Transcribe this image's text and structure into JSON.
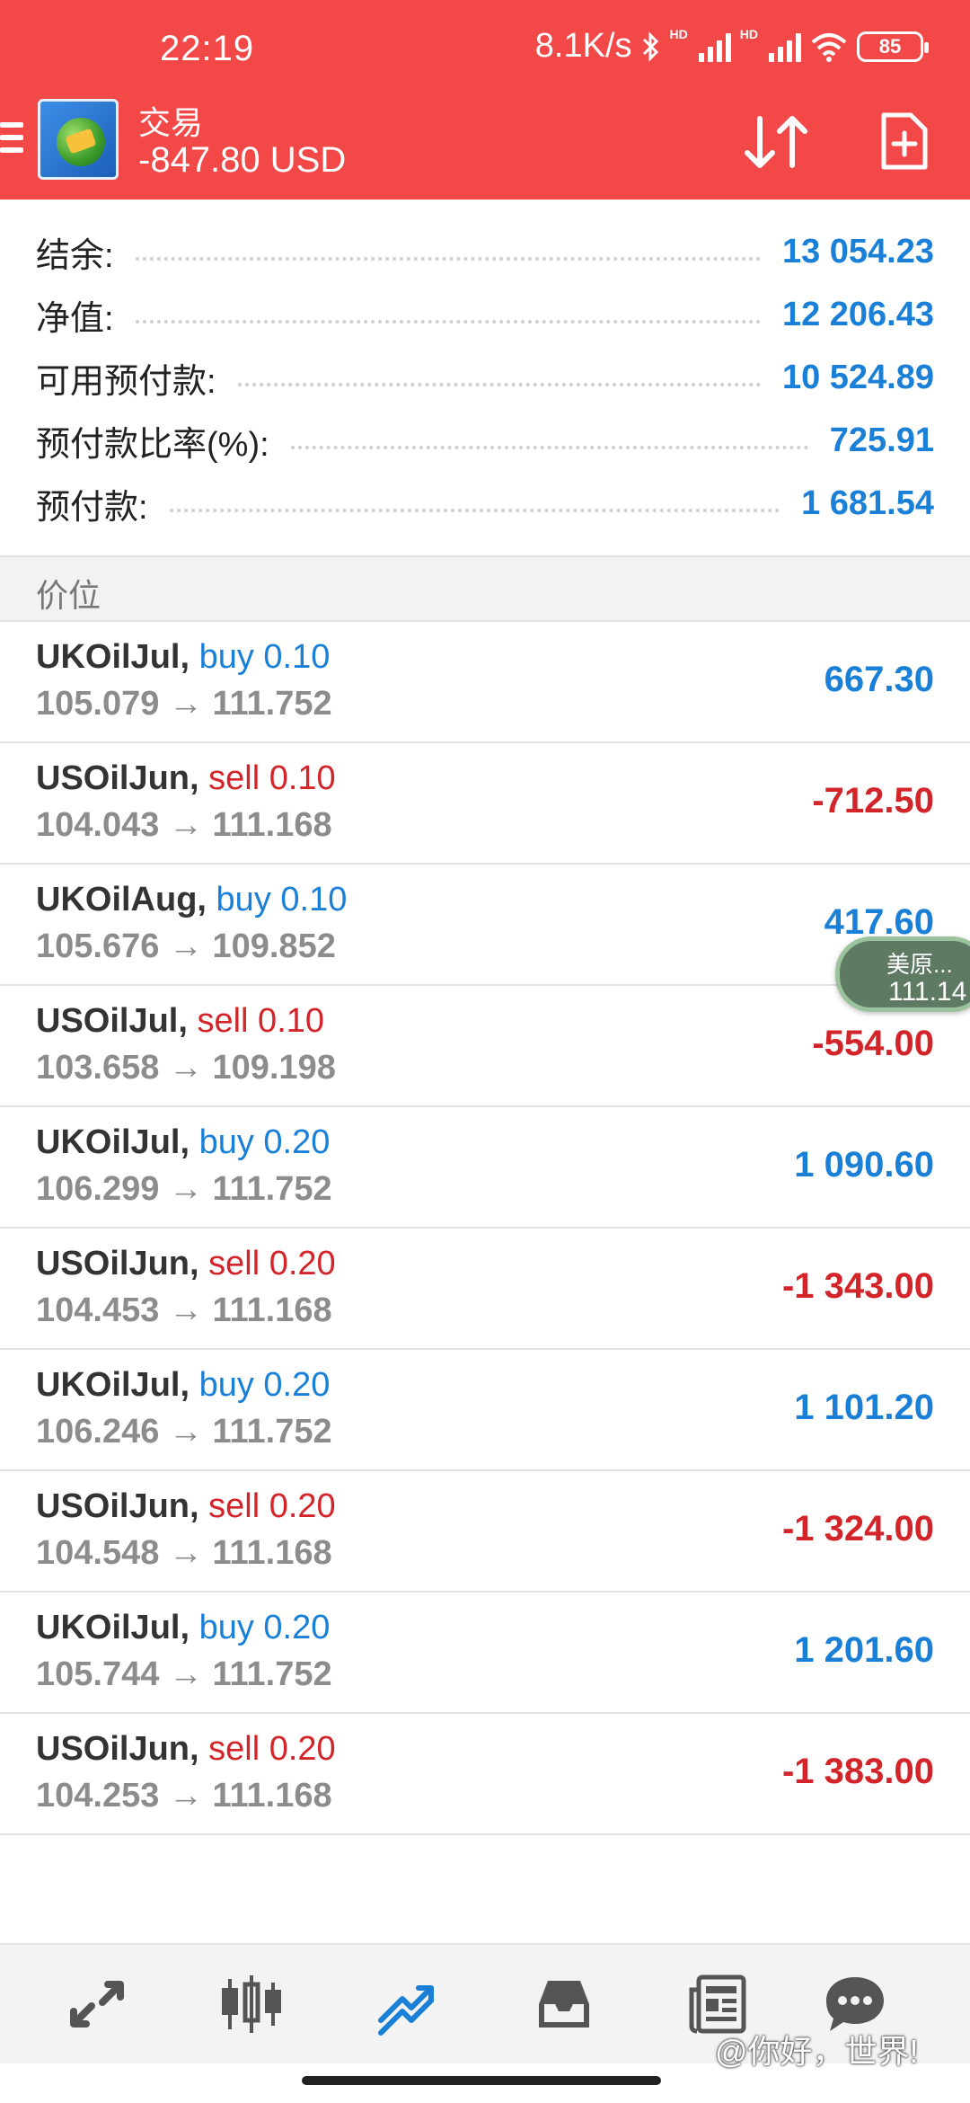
{
  "status_bar": {
    "time": "22:19",
    "net_speed": "8.1K/s",
    "battery": "85",
    "hd1": "HD",
    "hd2": "HD"
  },
  "header": {
    "title": "交易",
    "balance_line": "-847.80 USD"
  },
  "account": [
    {
      "label": "结余:",
      "value": "13 054.23"
    },
    {
      "label": "净值:",
      "value": "12 206.43"
    },
    {
      "label": "可用预付款:",
      "value": "10 524.89"
    },
    {
      "label": "预付款比率(%):",
      "value": "725.91"
    },
    {
      "label": "预付款:",
      "value": "1 681.54"
    }
  ],
  "section_label": "价位",
  "positions": [
    {
      "symbol": "UKOilJul,",
      "dir": "buy 0.10",
      "side": "buy",
      "prices": "105.079 → 111.752",
      "pl": "667.30"
    },
    {
      "symbol": "USOilJun,",
      "dir": "sell 0.10",
      "side": "sell",
      "prices": "104.043 → 111.168",
      "pl": "-712.50"
    },
    {
      "symbol": "UKOilAug,",
      "dir": "buy 0.10",
      "side": "buy",
      "prices": "105.676 → 109.852",
      "pl": "417.60"
    },
    {
      "symbol": "USOilJul,",
      "dir": "sell 0.10",
      "side": "sell",
      "prices": "103.658 → 109.198",
      "pl": "-554.00"
    },
    {
      "symbol": "UKOilJul,",
      "dir": "buy 0.20",
      "side": "buy",
      "prices": "106.299 → 111.752",
      "pl": "1 090.60"
    },
    {
      "symbol": "USOilJun,",
      "dir": "sell 0.20",
      "side": "sell",
      "prices": "104.453 → 111.168",
      "pl": "-1 343.00"
    },
    {
      "symbol": "UKOilJul,",
      "dir": "buy 0.20",
      "side": "buy",
      "prices": "106.246 → 111.752",
      "pl": "1 101.20"
    },
    {
      "symbol": "USOilJun,",
      "dir": "sell 0.20",
      "side": "sell",
      "prices": "104.548 → 111.168",
      "pl": "-1 324.00"
    },
    {
      "symbol": "UKOilJul,",
      "dir": "buy 0.20",
      "side": "buy",
      "prices": "105.744 → 111.752",
      "pl": "1 201.60"
    },
    {
      "symbol": "USOilJun,",
      "dir": "sell 0.20",
      "side": "sell",
      "prices": "104.253 → 111.168",
      "pl": "-1 383.00"
    }
  ],
  "floating_bubble": {
    "label": "美原...",
    "value": "111.14"
  },
  "bottom_nav": [
    {
      "icon": "quotes-arrows-icon"
    },
    {
      "icon": "chart-candles-icon"
    },
    {
      "icon": "trade-icon",
      "active": true
    },
    {
      "icon": "history-inbox-icon"
    },
    {
      "icon": "news-icon"
    },
    {
      "icon": "messages-icon"
    }
  ],
  "watermark": "@你好，世界!",
  "colors": {
    "header_bg": "#f24848",
    "positive": "#1a7fd6",
    "negative": "#d3242a",
    "active_nav": "#1a7fd6"
  }
}
